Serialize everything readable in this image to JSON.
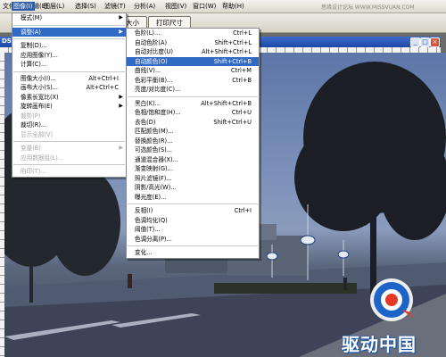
{
  "menubar": {
    "items": [
      "文件(F)",
      "编辑(E)",
      "图像(I)",
      "图层(L)",
      "选择(S)",
      "滤镜(T)",
      "分析(A)",
      "视图(V)",
      "窗口(W)",
      "帮助(H)"
    ],
    "watermark": "思缘设计论坛 WWW.MISSVUAN.COM"
  },
  "options_bar": {
    "btn_screen": "屏幕大小",
    "btn_print": "打印尺寸"
  },
  "document": {
    "title_fragment": "DS"
  },
  "image_menu": {
    "items": [
      {
        "label": "模式(M)",
        "arrow": "▶"
      },
      {
        "sep": true
      },
      {
        "label": "调整(A)",
        "arrow": "▶",
        "highlight": true
      },
      {
        "sep": true
      },
      {
        "label": "复制(D)..."
      },
      {
        "label": "应用图像(Y)..."
      },
      {
        "label": "计算(C)..."
      },
      {
        "sep": true
      },
      {
        "label": "图像大小(I)...",
        "shortcut": "Alt+Ctrl+I"
      },
      {
        "label": "画布大小(S)...",
        "shortcut": "Alt+Ctrl+C"
      },
      {
        "label": "像素长宽比(X)",
        "arrow": "▶"
      },
      {
        "label": "旋转画布(E)",
        "arrow": "▶"
      },
      {
        "label": "裁剪(P)",
        "disabled": true
      },
      {
        "label": "裁切(R)..."
      },
      {
        "label": "显示全部(V)",
        "disabled": true
      },
      {
        "sep": true
      },
      {
        "label": "变量(B)",
        "arrow": "▶",
        "disabled": true
      },
      {
        "label": "应用数据组(L)...",
        "disabled": true
      },
      {
        "sep": true
      },
      {
        "label": "陷印(T)...",
        "disabled": true
      }
    ]
  },
  "adjust_menu": {
    "items": [
      {
        "label": "色阶(L)...",
        "shortcut": "Ctrl+L"
      },
      {
        "label": "自动色阶(A)",
        "shortcut": "Shift+Ctrl+L"
      },
      {
        "label": "自动对比度(U)",
        "shortcut": "Alt+Shift+Ctrl+L"
      },
      {
        "label": "自动颜色(O)",
        "shortcut": "Shift+Ctrl+B",
        "highlight": true
      },
      {
        "label": "曲线(V)...",
        "shortcut": "Ctrl+M"
      },
      {
        "label": "色彩平衡(B)...",
        "shortcut": "Ctrl+B"
      },
      {
        "label": "亮度/对比度(C)..."
      },
      {
        "sep": true
      },
      {
        "label": "黑白(K)...",
        "shortcut": "Alt+Shift+Ctrl+B"
      },
      {
        "label": "色相/饱和度(H)...",
        "shortcut": "Ctrl+U"
      },
      {
        "label": "去色(D)",
        "shortcut": "Shift+Ctrl+U"
      },
      {
        "label": "匹配颜色(M)..."
      },
      {
        "label": "替换颜色(R)..."
      },
      {
        "label": "可选颜色(S)..."
      },
      {
        "label": "通道混合器(X)..."
      },
      {
        "label": "渐变映射(G)..."
      },
      {
        "label": "照片滤镜(F)..."
      },
      {
        "label": "阴影/高光(W)..."
      },
      {
        "label": "曝光度(E)..."
      },
      {
        "sep": true
      },
      {
        "label": "反相(I)",
        "shortcut": "Ctrl+I"
      },
      {
        "label": "色调均化(Q)"
      },
      {
        "label": "阈值(T)..."
      },
      {
        "label": "色调分离(P)..."
      },
      {
        "sep": true
      },
      {
        "label": "变化..."
      }
    ]
  },
  "brand": {
    "text": "驱动中国"
  },
  "colors": {
    "menu_highlight": "#316ac5",
    "title_blue": "#1c47a8"
  }
}
